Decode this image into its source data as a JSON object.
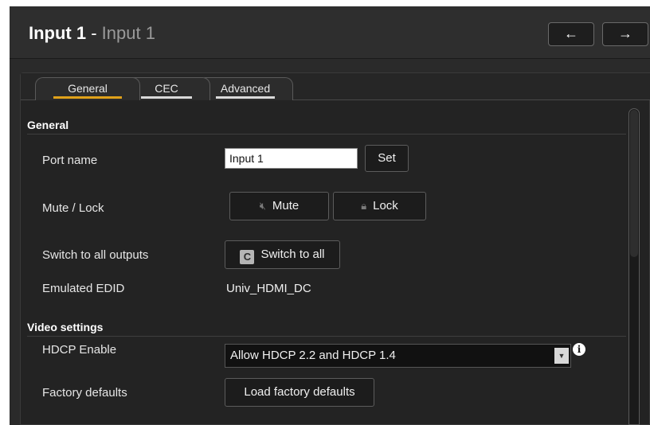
{
  "header": {
    "title_main": "Input 1",
    "title_sep": " - ",
    "title_sub": "Input 1",
    "prev_label": "←",
    "next_label": "→"
  },
  "tabs": [
    {
      "label": "General",
      "active": true
    },
    {
      "label": "CEC",
      "active": false
    },
    {
      "label": "Advanced",
      "active": false
    }
  ],
  "sections": {
    "general": "General",
    "video": "Video settings"
  },
  "general": {
    "port_name_label": "Port name",
    "port_name_value": "Input 1",
    "set_label": "Set",
    "mute_lock_label": "Mute / Lock",
    "mute_label": "Mute",
    "lock_label": "Lock",
    "switch_all_outputs_label": "Switch to all outputs",
    "switch_all_label": "Switch to all",
    "emulated_edid_label": "Emulated EDID",
    "emulated_edid_value": "Univ_HDMI_DC"
  },
  "video": {
    "hdcp_label": "HDCP Enable",
    "hdcp_value": "Allow HDCP 2.2 and HDCP 1.4",
    "factory_label": "Factory defaults",
    "factory_button_label": "Load factory defaults"
  },
  "icons": {
    "mute": "speaker-muted-icon",
    "lock": "padlock-icon",
    "switch": "c-switch-icon",
    "info": "info-icon",
    "dropdown": "chevron-down-icon"
  },
  "colors": {
    "active_tab_underline": "#e0a21a",
    "background": "#2a2a2a"
  }
}
